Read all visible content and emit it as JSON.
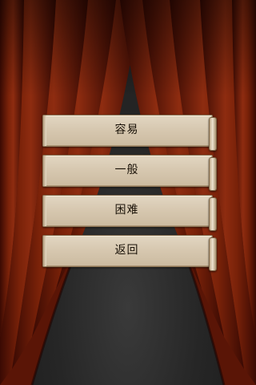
{
  "menu": {
    "buttons": [
      {
        "id": "easy",
        "label": "容易"
      },
      {
        "id": "normal",
        "label": "一般"
      },
      {
        "id": "hard",
        "label": "困难"
      },
      {
        "id": "back",
        "label": "返回"
      }
    ]
  },
  "colors": {
    "curtain_dark": "#2a0502",
    "curtain_mid": "#6b1a08",
    "curtain_light": "#8c2a10",
    "button_face": "#d7c8b0",
    "button_text": "#1a1208",
    "stage_floor": "#262626"
  }
}
